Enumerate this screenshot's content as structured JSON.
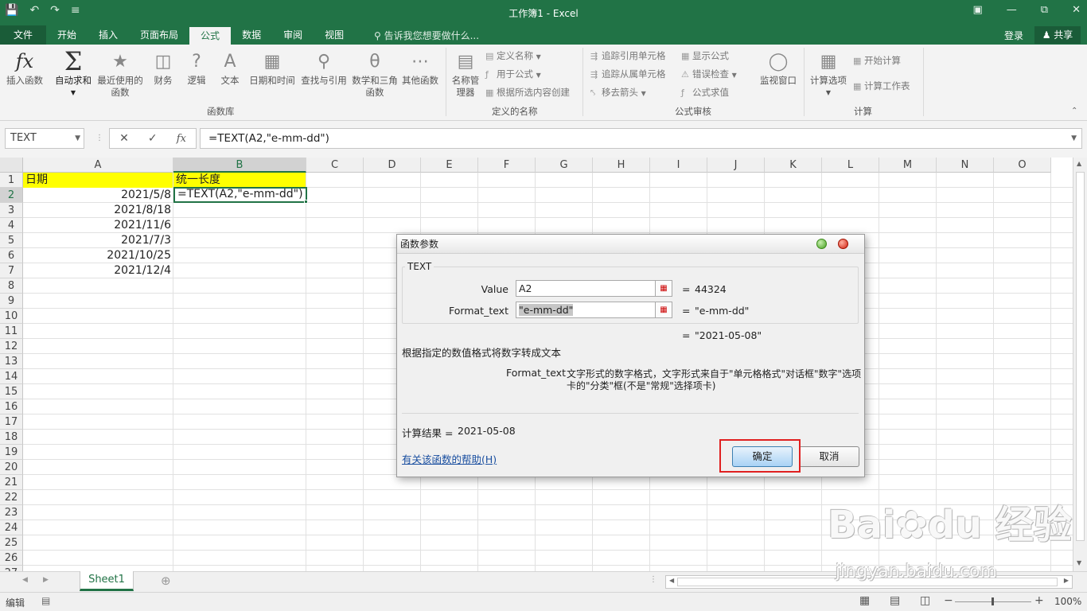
{
  "window": {
    "title": "工作簿1 - Excel",
    "qat_icons": [
      "save-icon",
      "undo-icon",
      "redo-icon",
      "customize-icon"
    ]
  },
  "menu": {
    "tabs": [
      "文件",
      "开始",
      "插入",
      "页面布局",
      "公式",
      "数据",
      "审阅",
      "视图"
    ],
    "active_tab": "公式",
    "tell_me": "告诉我您想要做什么...",
    "sign_in": "登录",
    "share": "共享"
  },
  "ribbon": {
    "function_library": {
      "group_label": "函数库",
      "insert_function": "插入函数",
      "autosum": "自动求和",
      "recently_used": "最近使用的函数",
      "financial": "财务",
      "logical": "逻辑",
      "text": "文本",
      "date_time": "日期和时间",
      "lookup_ref": "查找与引用",
      "math_trig": "数学和三角函数",
      "more_functions": "其他函数"
    },
    "defined_names": {
      "group_label": "定义的名称",
      "name_manager": "名称管理器",
      "define_name": "定义名称",
      "use_in_formula": "用于公式",
      "create_from_selection": "根据所选内容创建"
    },
    "formula_auditing": {
      "group_label": "公式审核",
      "trace_precedents": "追踪引用单元格",
      "trace_dependents": "追踪从属单元格",
      "remove_arrows": "移去箭头",
      "show_formulas": "显示公式",
      "error_checking": "错误检查",
      "evaluate_formula": "公式求值",
      "watch_window": "监视窗口"
    },
    "calculation": {
      "group_label": "计算",
      "calc_options": "计算选项",
      "calc_now": "开始计算",
      "calc_sheet": "计算工作表"
    }
  },
  "formula_bar": {
    "name_box": "TEXT",
    "fx_label": "fx",
    "formula": "=TEXT(A2,\"e-mm-dd\")"
  },
  "grid": {
    "columns": [
      "A",
      "B",
      "C",
      "D",
      "E",
      "F",
      "G",
      "H",
      "I",
      "J",
      "K",
      "L",
      "M",
      "N",
      "O"
    ],
    "rows": [
      "1",
      "2",
      "3",
      "4",
      "5",
      "6",
      "7",
      "8",
      "9",
      "10",
      "11",
      "12",
      "13",
      "14",
      "15",
      "16",
      "17",
      "18",
      "19",
      "20",
      "21",
      "22",
      "23",
      "24",
      "25",
      "26",
      "27"
    ],
    "cells": {
      "A1": "日期",
      "B1": "统一长度",
      "A2": "2021/5/8",
      "B2": "=TEXT(A2,\"e-mm-dd\")",
      "A3": "2021/8/18",
      "A4": "2021/11/6",
      "A5": "2021/7/3",
      "A6": "2021/10/25",
      "A7": "2021/12/4"
    },
    "header_color": "#ffff00",
    "selection_color": "#217346"
  },
  "sheets": {
    "tabs": [
      "Sheet1"
    ],
    "add_icon": "plus-circle-icon"
  },
  "status": {
    "mode": "编辑",
    "zoom": "100%"
  },
  "dialog": {
    "title": "函数参数",
    "function_name": "TEXT",
    "args": [
      {
        "label": "Value",
        "input": "A2",
        "result": "44324"
      },
      {
        "label": "Format_text",
        "input": "\"e-mm-dd\"",
        "result": "\"e-mm-dd\""
      }
    ],
    "func_result": "\"2021-05-08\"",
    "description": "根据指定的数值格式将数字转成文本",
    "arg_help_label": "Format_text",
    "arg_help_line1": "文字形式的数字格式，文字形式来自于\"单元格格式\"对话框\"数字\"选项",
    "arg_help_line2": "卡的\"分类\"框(不是\"常规\"选择项卡)",
    "calc_result_label": "计算结果 =",
    "calc_result_value": "2021-05-08",
    "help_link": "有关该函数的帮助(H)",
    "ok_label": "确定",
    "cancel_label": "取消",
    "equals": "="
  },
  "watermark": {
    "text": "Bai du 经验",
    "sub": "jingyan.baidu.com"
  }
}
